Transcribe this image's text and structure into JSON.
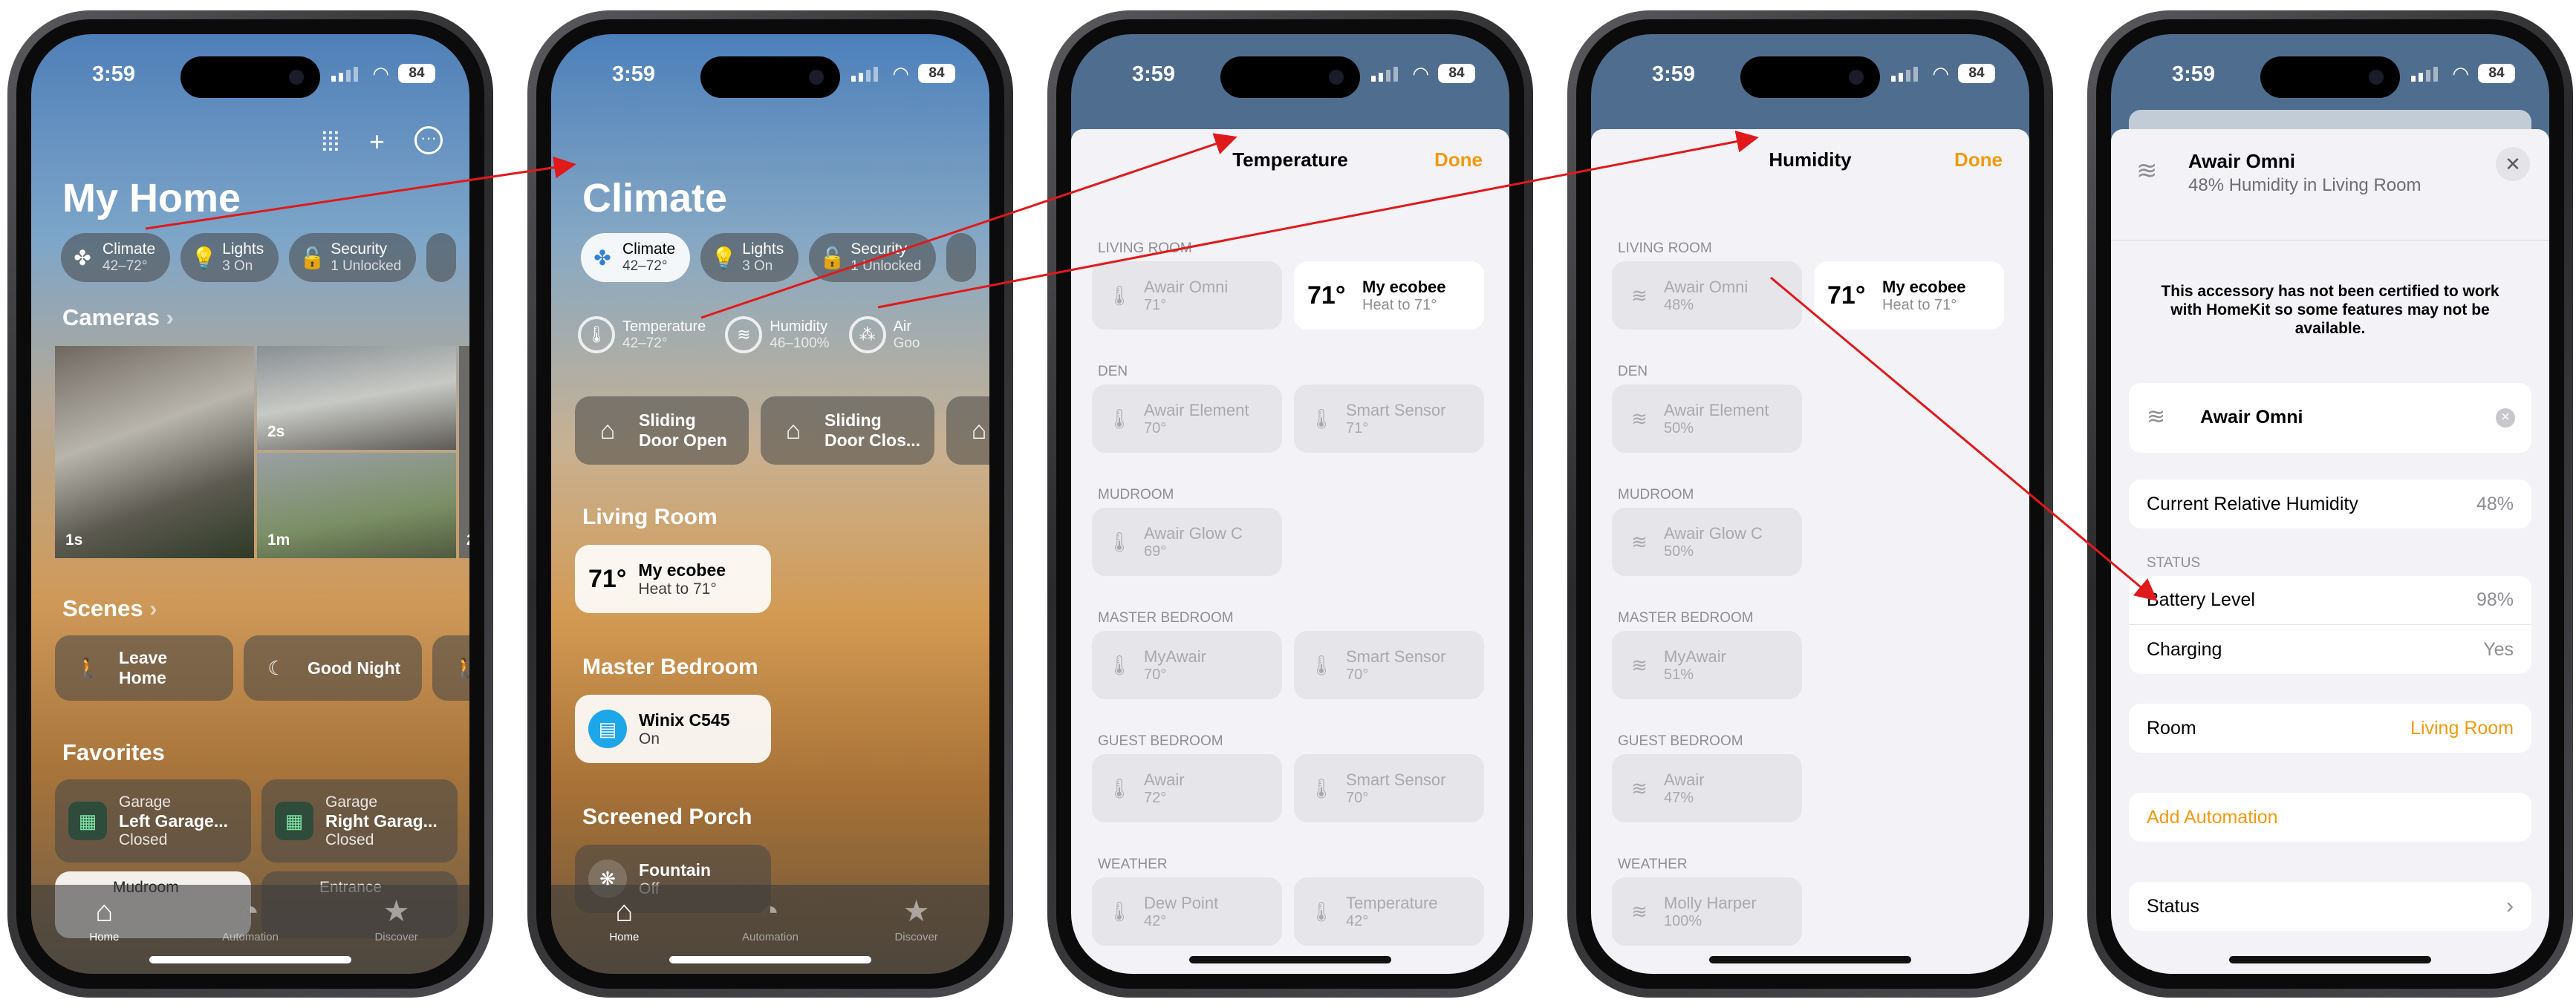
{
  "status_bar": {
    "time": "3:59",
    "battery": "84"
  },
  "phone1": {
    "title": "My Home",
    "chips": [
      {
        "icon": "fan-icon",
        "label": "Climate",
        "sub": "42–72°"
      },
      {
        "icon": "bulb-icon",
        "label": "Lights",
        "sub": "3 On"
      },
      {
        "icon": "lock-icon",
        "label": "Security",
        "sub": "1 Unlocked"
      }
    ],
    "cameras_label": "Cameras",
    "cameras": [
      {
        "timestamp": "1s"
      },
      {
        "timestamp": "2s"
      },
      {
        "timestamp": "1m"
      },
      {
        "timestamp": "2"
      }
    ],
    "scenes_label": "Scenes",
    "scenes": [
      {
        "label": "Leave Home",
        "icon": "walk-icon"
      },
      {
        "label": "Good Night",
        "icon": "moon-icon"
      }
    ],
    "favorites_label": "Favorites",
    "favorites": [
      {
        "room": "Garage",
        "name": "Left Garage...",
        "status": "Closed"
      },
      {
        "room": "Garage",
        "name": "Right Garag...",
        "status": "Closed"
      },
      {
        "room": "Mudroom",
        "name": "",
        "status": ""
      },
      {
        "room": "Entrance",
        "name": "",
        "status": ""
      }
    ]
  },
  "tabs": [
    {
      "label": "Home",
      "icon": "house-icon"
    },
    {
      "label": "Automation",
      "icon": "clock-icon"
    },
    {
      "label": "Discover",
      "icon": "star-icon"
    }
  ],
  "phone2": {
    "title": "Climate",
    "chips": [
      {
        "label": "Climate",
        "sub": "42–72°"
      },
      {
        "label": "Lights",
        "sub": "3 On"
      },
      {
        "label": "Security",
        "sub": "1 Unlocked"
      }
    ],
    "sensors": [
      {
        "label": "Temperature",
        "sub": "42–72°"
      },
      {
        "label": "Humidity",
        "sub": "46–100%"
      },
      {
        "label": "Air",
        "sub": "Goo"
      }
    ],
    "doors": [
      {
        "l1": "Sliding",
        "l2": "Door Open"
      },
      {
        "l1": "Sliding",
        "l2": "Door Clos..."
      }
    ],
    "living_room": "Living Room",
    "ecobee": {
      "temp": "71°",
      "name": "My ecobee",
      "sub": "Heat to 71°"
    },
    "master_bedroom": "Master Bedroom",
    "winix": {
      "name": "Winix C545",
      "sub": "On"
    },
    "screened_porch": "Screened Porch",
    "fountain": {
      "name": "Fountain",
      "sub": "Off"
    }
  },
  "phone3": {
    "title": "Temperature",
    "done": "Done",
    "rooms": [
      {
        "name": "LIVING ROOM",
        "items": [
          {
            "name": "Awair Omni",
            "value": "71°"
          },
          {
            "name": "My ecobee",
            "value": "Heat to 71°",
            "big": "71°",
            "on": true
          }
        ]
      },
      {
        "name": "DEN",
        "items": [
          {
            "name": "Awair Element",
            "value": "70°"
          },
          {
            "name": "Smart Sensor",
            "value": "71°"
          }
        ]
      },
      {
        "name": "MUDROOM",
        "items": [
          {
            "name": "Awair Glow C",
            "value": "69°"
          }
        ]
      },
      {
        "name": "MASTER BEDROOM",
        "items": [
          {
            "name": "MyAwair",
            "value": "70°"
          },
          {
            "name": "Smart Sensor",
            "value": "70°"
          }
        ]
      },
      {
        "name": "GUEST BEDROOM",
        "items": [
          {
            "name": "Awair",
            "value": "72°"
          },
          {
            "name": "Smart Sensor",
            "value": "70°"
          }
        ]
      },
      {
        "name": "WEATHER",
        "items": [
          {
            "name": "Dew Point",
            "value": "42°"
          },
          {
            "name": "Temperature",
            "value": "42°"
          }
        ]
      }
    ]
  },
  "phone4": {
    "title": "Humidity",
    "done": "Done",
    "rooms": [
      {
        "name": "LIVING ROOM",
        "items": [
          {
            "name": "Awair Omni",
            "value": "48%"
          },
          {
            "name": "My ecobee",
            "value": "Heat to 71°",
            "big": "71°",
            "on": true
          }
        ]
      },
      {
        "name": "DEN",
        "items": [
          {
            "name": "Awair Element",
            "value": "50%"
          }
        ]
      },
      {
        "name": "MUDROOM",
        "items": [
          {
            "name": "Awair Glow C",
            "value": "50%"
          }
        ]
      },
      {
        "name": "MASTER BEDROOM",
        "items": [
          {
            "name": "MyAwair",
            "value": "51%"
          }
        ]
      },
      {
        "name": "GUEST BEDROOM",
        "items": [
          {
            "name": "Awair",
            "value": "47%"
          }
        ]
      },
      {
        "name": "WEATHER",
        "items": [
          {
            "name": "Molly Harper",
            "value": "100%"
          }
        ]
      }
    ]
  },
  "phone5": {
    "name": "Awair Omni",
    "subtitle": "48% Humidity in Living Room",
    "notice": "This accessory has not been certified to work with HomeKit so some features may not be available.",
    "accessory_name": "Awair Omni",
    "humidity_label": "Current Relative Humidity",
    "humidity_value": "48%",
    "status_header": "STATUS",
    "battery_label": "Battery Level",
    "battery_value": "98%",
    "charging_label": "Charging",
    "charging_value": "Yes",
    "room_label": "Room",
    "room_value": "Living Room",
    "add_automation": "Add Automation",
    "status_label": "Status"
  },
  "colors": {
    "accent": "#f19a0d",
    "arrow": "#e0191b"
  }
}
